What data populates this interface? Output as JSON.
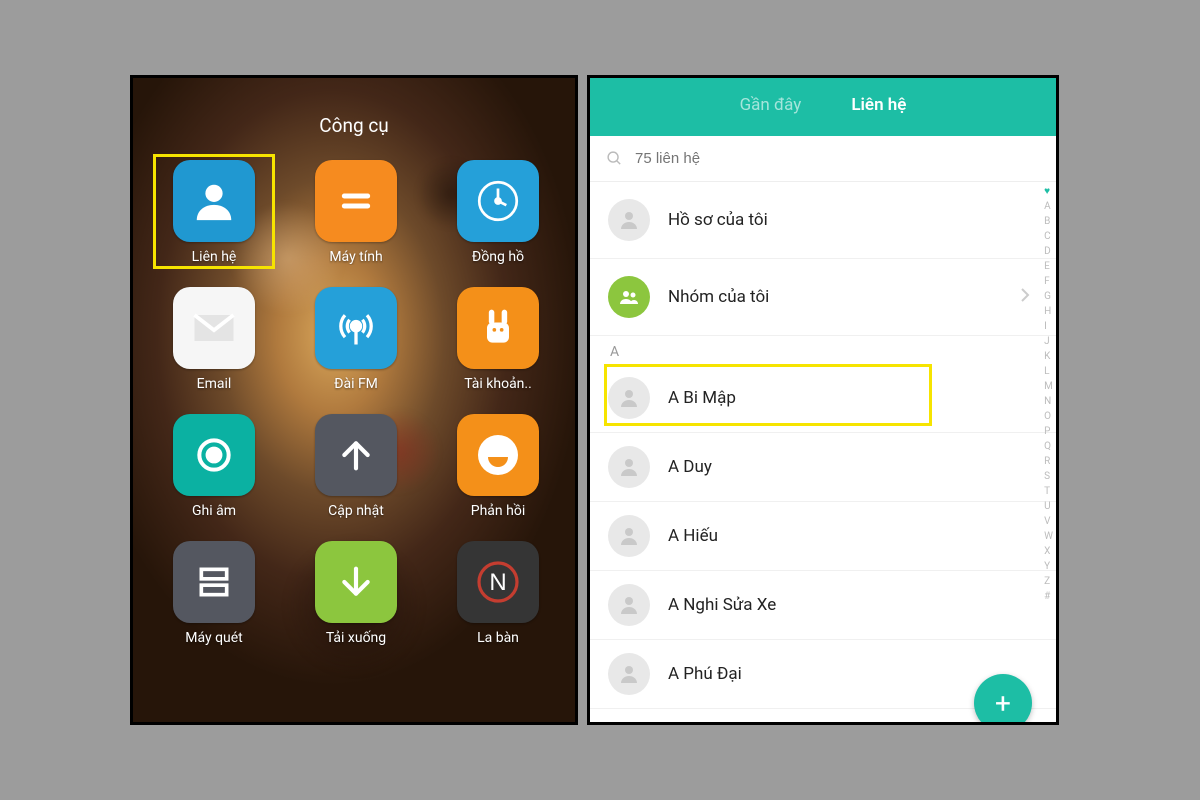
{
  "left": {
    "folder_title": "Công cụ",
    "apps": [
      {
        "id": "contacts",
        "label": "Liên hệ",
        "bg": "bg-blue",
        "icon": "person",
        "highlighted": true
      },
      {
        "id": "calculator",
        "label": "Máy tính",
        "bg": "bg-orange",
        "icon": "equals"
      },
      {
        "id": "clock",
        "label": "Đồng hồ",
        "bg": "bg-skyblue",
        "icon": "clock"
      },
      {
        "id": "email",
        "label": "Email",
        "bg": "bg-white",
        "icon": "envelope"
      },
      {
        "id": "fm",
        "label": "Đài FM",
        "bg": "bg-skyblue",
        "icon": "antenna"
      },
      {
        "id": "account",
        "label": "Tài khoản..",
        "bg": "bg-forange",
        "icon": "mi-bunny"
      },
      {
        "id": "recorder",
        "label": "Ghi âm",
        "bg": "bg-teal",
        "icon": "record"
      },
      {
        "id": "updater",
        "label": "Cập nhật",
        "bg": "bg-gray",
        "icon": "arrow-up"
      },
      {
        "id": "feedback",
        "label": "Phản hồi",
        "bg": "bg-forange",
        "icon": "smile"
      },
      {
        "id": "scanner",
        "label": "Máy quét",
        "bg": "bg-gray",
        "icon": "scan"
      },
      {
        "id": "downloads",
        "label": "Tải xuống",
        "bg": "bg-green",
        "icon": "arrow-down"
      },
      {
        "id": "compass",
        "label": "La bàn",
        "bg": "bg-dark",
        "icon": "compass-n"
      }
    ]
  },
  "right": {
    "tabs": {
      "recent": "Gần đây",
      "contacts": "Liên hệ"
    },
    "search_placeholder": "75 liên hệ",
    "profile": "Hồ sơ của tôi",
    "groups": "Nhóm của tôi",
    "section_letter": "A",
    "contacts": [
      {
        "name": "A Bi Mập",
        "highlighted": true
      },
      {
        "name": "A Duy"
      },
      {
        "name": "A Hiếu"
      },
      {
        "name": "A Nghi Sửa Xe"
      },
      {
        "name": "A Phú Đại"
      }
    ],
    "index": [
      "♥",
      "A",
      "B",
      "C",
      "D",
      "E",
      "F",
      "G",
      "H",
      "I",
      "J",
      "K",
      "L",
      "M",
      "N",
      "O",
      "P",
      "Q",
      "R",
      "S",
      "T",
      "U",
      "V",
      "W",
      "X",
      "Y",
      "Z",
      "#"
    ]
  }
}
